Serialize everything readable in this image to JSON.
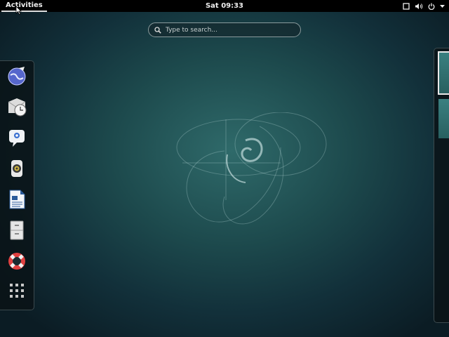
{
  "topbar": {
    "activities_label": "Activities",
    "clock": "Sat 09:33",
    "tray_icons": [
      "window-icon",
      "volume-icon",
      "power-icon",
      "menu-arrow-icon"
    ]
  },
  "search": {
    "placeholder": "Type to search..."
  },
  "dash": {
    "apps": [
      "web-browser-icon",
      "mail-clock-icon",
      "chat-icon",
      "speaker-icon",
      "writer-document-icon",
      "file-cabinet-icon",
      "help-lifebuoy-icon",
      "show-applications-icon"
    ]
  },
  "workspaces": {
    "count": 2,
    "active": 1
  },
  "colors": {
    "background": "#1d4a4d",
    "topbar": "#000000",
    "workspace": "#3a8080"
  }
}
